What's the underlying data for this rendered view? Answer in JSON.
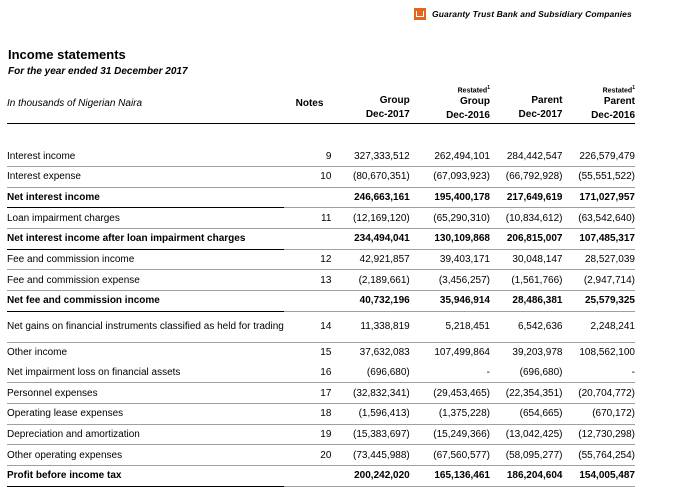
{
  "header": {
    "bank_name": "Guaranty Trust Bank and Subsidiary Companies"
  },
  "title": "Income statements",
  "subtitle": "For the year ended 31 December 2017",
  "columns": {
    "label_header": "In thousands of Nigerian Naira",
    "notes_header": "Notes",
    "restated_tag": "Restated",
    "restated_sup": "1",
    "cols": [
      {
        "entity": "Group",
        "period": "Dec-2017",
        "restated": false
      },
      {
        "entity": "Group",
        "period": "Dec-2016",
        "restated": true
      },
      {
        "entity": "Parent",
        "period": "Dec-2017",
        "restated": false
      },
      {
        "entity": "Parent",
        "period": "Dec-2016",
        "restated": true
      }
    ]
  },
  "rows": [
    {
      "label": "Interest income",
      "note": "9",
      "v": [
        "327,333,512",
        "262,494,101",
        "284,442,547",
        "226,579,479"
      ],
      "bold": false
    },
    {
      "label": "Interest expense",
      "note": "10",
      "v": [
        "(80,670,351)",
        "(67,093,923)",
        "(66,792,928)",
        "(55,551,522)"
      ],
      "bold": false
    },
    {
      "label": "Net interest income",
      "note": "",
      "v": [
        "246,663,161",
        "195,400,178",
        "217,649,619",
        "171,027,957"
      ],
      "bold": true
    },
    {
      "label": "Loan impairment charges",
      "note": "11",
      "v": [
        "(12,169,120)",
        "(65,290,310)",
        "(10,834,612)",
        "(63,542,640)"
      ],
      "bold": false
    },
    {
      "label": "Net interest income after loan impairment charges",
      "note": "",
      "v": [
        "234,494,041",
        "130,109,868",
        "206,815,007",
        "107,485,317"
      ],
      "bold": true
    },
    {
      "label": "Fee and commission income",
      "note": "12",
      "v": [
        "42,921,857",
        "39,403,171",
        "30,048,147",
        "28,527,039"
      ],
      "bold": false
    },
    {
      "label": "Fee and commission expense",
      "note": "13",
      "v": [
        "(2,189,661)",
        "(3,456,257)",
        "(1,561,766)",
        "(2,947,714)"
      ],
      "bold": false
    },
    {
      "label": "Net fee and commission income",
      "note": "",
      "v": [
        "40,732,196",
        "35,946,914",
        "28,486,381",
        "25,579,325"
      ],
      "bold": true
    },
    {
      "label": "Net gains on financial instruments classified as held for trading",
      "note": "14",
      "v": [
        "11,338,819",
        "5,218,451",
        "6,542,636",
        "2,248,241"
      ],
      "bold": false,
      "tall": true
    },
    {
      "label": "Other income",
      "note": "15",
      "v": [
        "37,632,083",
        "107,499,864",
        "39,203,978",
        "108,562,100"
      ],
      "bold": false,
      "nobd": true
    },
    {
      "label": "Net impairment loss on financial assets",
      "note": "16",
      "v": [
        "(696,680)",
        "-",
        "(696,680)",
        "-"
      ],
      "bold": false
    },
    {
      "label": "Personnel expenses",
      "note": "17",
      "v": [
        "(32,832,341)",
        "(29,453,465)",
        "(22,354,351)",
        "(20,704,772)"
      ],
      "bold": false
    },
    {
      "label": "Operating lease expenses",
      "note": "18",
      "v": [
        "(1,596,413)",
        "(1,375,228)",
        "(654,665)",
        "(670,172)"
      ],
      "bold": false
    },
    {
      "label": "Depreciation and amortization",
      "note": "19",
      "v": [
        "(15,383,697)",
        "(15,249,366)",
        "(13,042,425)",
        "(12,730,298)"
      ],
      "bold": false
    },
    {
      "label": "Other operating expenses",
      "note": "20",
      "v": [
        "(73,445,988)",
        "(67,560,577)",
        "(58,095,277)",
        "(55,764,254)"
      ],
      "bold": false
    },
    {
      "label": "Profit before income tax",
      "note": "",
      "v": [
        "200,242,020",
        "165,136,461",
        "186,204,604",
        "154,005,487"
      ],
      "bold": true
    }
  ]
}
